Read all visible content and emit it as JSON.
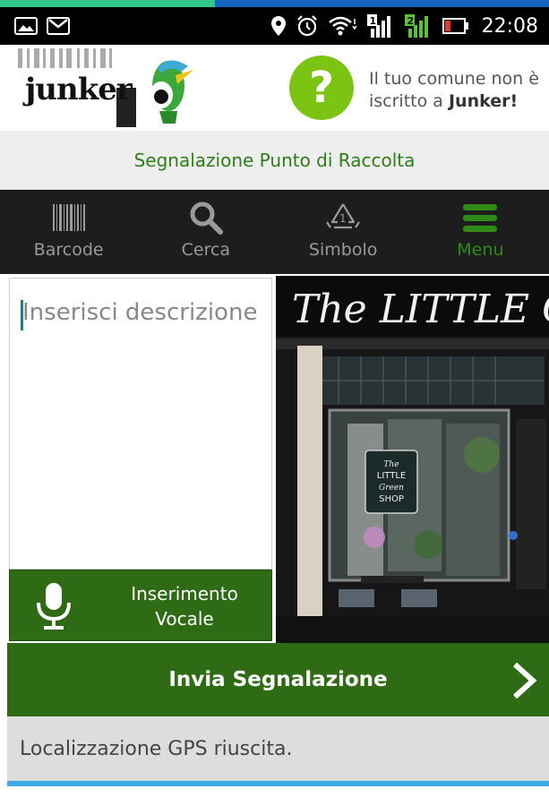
{
  "status_bar": {
    "time": "22:08",
    "icons": [
      "image-icon",
      "gmail-icon",
      "location-icon",
      "alarm-icon",
      "wifi-icon",
      "sim1-signal-icon",
      "sim2-signal-icon",
      "battery-icon"
    ],
    "sim1_label": "1",
    "sim2_label": "2"
  },
  "header": {
    "logo_text": "junker",
    "help_symbol": "?",
    "message_prefix": "Il tuo comune non è iscritto a ",
    "message_brand": "Junker!"
  },
  "page_title": "Segnalazione Punto di Raccolta",
  "nav": [
    {
      "label": "Barcode",
      "icon": "barcode-icon"
    },
    {
      "label": "Cerca",
      "icon": "search-icon"
    },
    {
      "label": "Simbolo",
      "icon": "recycle-symbol-icon"
    },
    {
      "label": "Menu",
      "icon": "menu-icon"
    }
  ],
  "description": {
    "placeholder": "Inserisci descrizione"
  },
  "voice_button": {
    "line1": "Inserimento",
    "line2": "Vocale"
  },
  "photo": {
    "sign_top": "The LITTLE Green",
    "shop_line1": "The",
    "shop_line2": "LITTLE",
    "shop_line3": "Green",
    "shop_line4": "SHOP"
  },
  "send_button": {
    "label": "Invia Segnalazione"
  },
  "gps_status": "Localizzazione GPS riuscita.",
  "colors": {
    "primary_green": "#2e6b14",
    "title_green": "#2e7d17",
    "help_green": "#7cc414",
    "nav_bg": "#1d1d1d",
    "accent_blue": "#3fa9e6"
  }
}
